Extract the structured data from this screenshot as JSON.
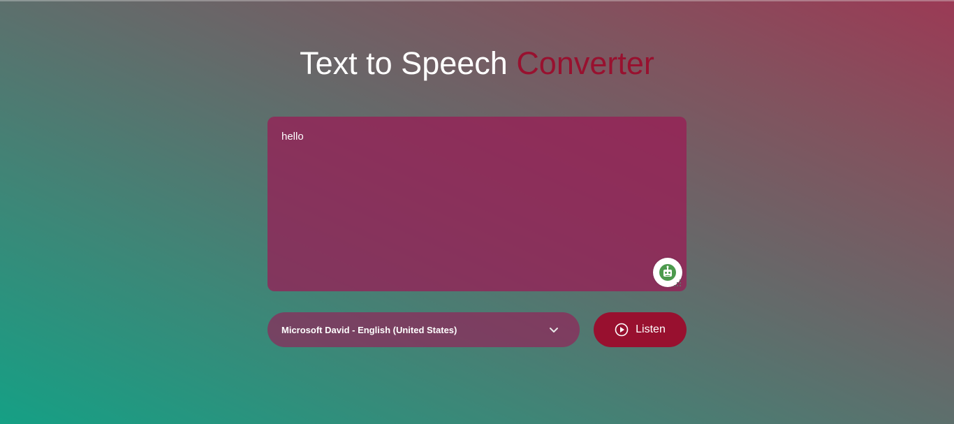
{
  "header": {
    "title_main": "Text to Speech",
    "title_accent": "Converter"
  },
  "editor": {
    "value": "hello"
  },
  "voice_select": {
    "selected": "Microsoft David - English (United States)"
  },
  "listen_button": {
    "label": "Listen"
  },
  "colors": {
    "accent": "#98112f",
    "panel": "#9b1955",
    "gradient_start": "#15a085",
    "gradient_end": "#9b3a55"
  },
  "icons": {
    "assistant": "robot-icon",
    "dropdown": "chevron-down-icon",
    "play": "play-circle-icon",
    "grip": "resize-grip-icon"
  }
}
